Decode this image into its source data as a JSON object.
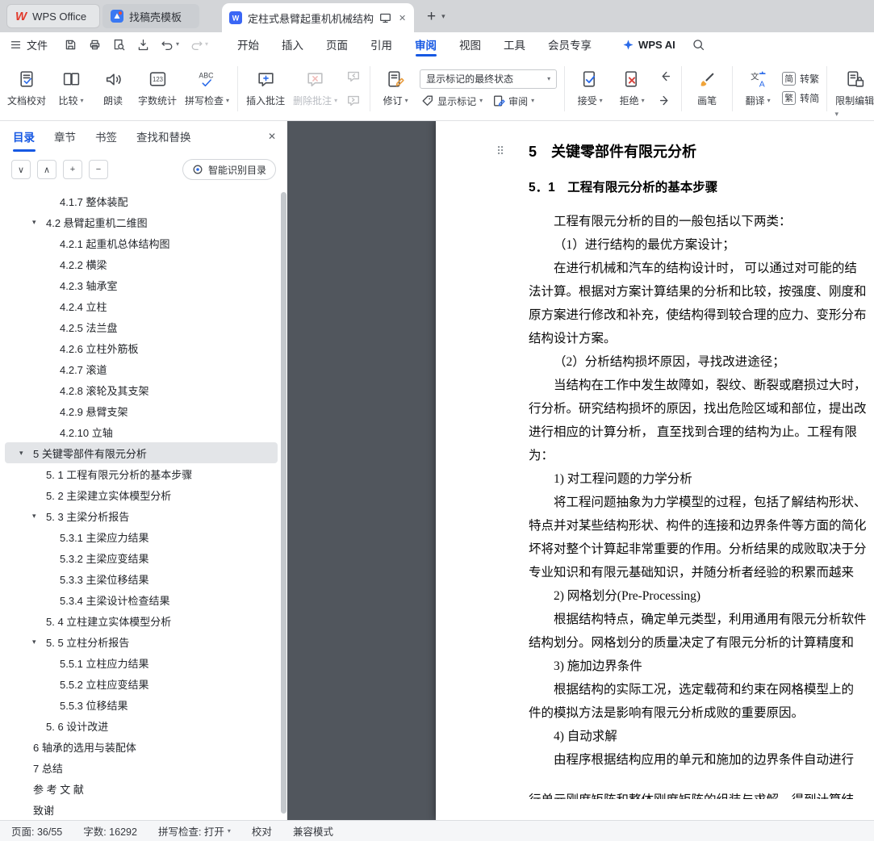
{
  "icons": {
    "close": "✕",
    "plus": "+",
    "caret": "▾",
    "tree_arrow": "▾",
    "chevron_down": "∨",
    "chevron_up": "∧",
    "minus": "−",
    "handle": "⠿"
  },
  "tabbar": {
    "home_tab": "WPS Office",
    "app_tab": "找稿壳模板",
    "doc_tab": "定柱式悬臂起重机机械结构设"
  },
  "menubar": {
    "file": "文件",
    "items": [
      {
        "label": "开始"
      },
      {
        "label": "插入"
      },
      {
        "label": "页面"
      },
      {
        "label": "引用"
      },
      {
        "label": "审阅",
        "active": true
      },
      {
        "label": "视图"
      },
      {
        "label": "工具"
      },
      {
        "label": "会员专享"
      }
    ],
    "wps_ai": "WPS AI"
  },
  "ribbon": {
    "doc_proof": "文档校对",
    "compare": "比较",
    "read_aloud": "朗读",
    "word_count": "字数统计",
    "spell_check": "拼写检查",
    "insert_comment": "插入批注",
    "delete_comment": "删除批注",
    "track_changes": "修订",
    "markup_state": "显示标记的最终状态",
    "show_markup": "显示标记",
    "review": "审阅",
    "accept": "接受",
    "reject": "拒绝",
    "brush": "画笔",
    "translate": "翻译",
    "jian": "简",
    "fan": "繁",
    "to_trad": "转繁",
    "to_simp": "转简",
    "restrict": "限制编辑"
  },
  "sidebar": {
    "tabs": [
      {
        "label": "目录",
        "active": true
      },
      {
        "label": "章节"
      },
      {
        "label": "书签"
      },
      {
        "label": "查找和替换"
      }
    ],
    "smart_button": "智能识别目录",
    "tree": [
      {
        "label": "4.1.7 整体装配",
        "level": 3
      },
      {
        "label": "4.2 悬臂起重机二维图",
        "level": 2,
        "arrow": true
      },
      {
        "label": "4.2.1 起重机总体结构图",
        "level": 3
      },
      {
        "label": "4.2.2 横梁",
        "level": 3
      },
      {
        "label": "4.2.3 轴承室",
        "level": 3
      },
      {
        "label": "4.2.4 立柱",
        "level": 3
      },
      {
        "label": "4.2.5 法兰盘",
        "level": 3
      },
      {
        "label": "4.2.6 立柱外筋板",
        "level": 3
      },
      {
        "label": "4.2.7 滚道",
        "level": 3
      },
      {
        "label": "4.2.8 滚轮及其支架",
        "level": 3
      },
      {
        "label": "4.2.9 悬臂支架",
        "level": 3
      },
      {
        "label": "4.2.10 立轴",
        "level": 3
      },
      {
        "label": "5 关键零部件有限元分析",
        "level": 1,
        "arrow": true,
        "selected": true
      },
      {
        "label": "5. 1 工程有限元分析的基本步骤",
        "level": 2
      },
      {
        "label": "5. 2 主梁建立实体模型分析",
        "level": 2
      },
      {
        "label": "5. 3 主梁分析报告",
        "level": 2,
        "arrow": true
      },
      {
        "label": "5.3.1 主梁应力结果",
        "level": 3
      },
      {
        "label": "5.3.2 主梁应变结果",
        "level": 3
      },
      {
        "label": "5.3.3 主梁位移结果",
        "level": 3
      },
      {
        "label": "5.3.4 主梁设计检查结果",
        "level": 3
      },
      {
        "label": "5. 4 立柱建立实体模型分析",
        "level": 2
      },
      {
        "label": "5. 5 立柱分析报告",
        "level": 2,
        "arrow": true
      },
      {
        "label": "5.5.1 立柱应力结果",
        "level": 3
      },
      {
        "label": "5.5.2 立柱应变结果",
        "level": 3
      },
      {
        "label": "5.5.3 位移结果",
        "level": 3
      },
      {
        "label": "5. 6 设计改进",
        "level": 2
      },
      {
        "label": "6 轴承的选用与装配体",
        "level": 1
      },
      {
        "label": "7 总结",
        "level": 1
      },
      {
        "label": "参 考 文 献",
        "level": 1
      },
      {
        "label": "致谢",
        "level": 1
      }
    ]
  },
  "document": {
    "heading1": "5　关键零部件有限元分析",
    "heading2": "5．1　工程有限元分析的基本步骤",
    "lines": [
      {
        "t": "工程有限元分析的目的一般包括以下两类：",
        "ind": true
      },
      {
        "t": "（1）进行结构的最优方案设计；",
        "ind": true
      },
      {
        "t": "在进行机械和汽车的结构设计时， 可以通过对可能的结",
        "ind": true
      },
      {
        "t": "法计算。根据对方案计算结果的分析和比较，按强度、刚度和"
      },
      {
        "t": "原方案进行修改和补充，使结构得到较合理的应力、变形分布"
      },
      {
        "t": "结构设计方案。"
      },
      {
        "t": "（2）分析结构损坏原因，寻找改进途径；",
        "ind": true
      },
      {
        "t": "当结构在工作中发生故障如，裂纹、断裂或磨损过大时，",
        "ind": true
      },
      {
        "t": "行分析。研究结构损坏的原因，找出危险区域和部位，提出改"
      },
      {
        "t": "进行相应的计算分析， 直至找到合理的结构为止。工程有限"
      },
      {
        "t": "为："
      },
      {
        "t": "1) 对工程问题的力学分析",
        "ind": true
      },
      {
        "t": "将工程问题抽象为力学模型的过程，包括了解结构形状、",
        "ind": true
      },
      {
        "t": "特点并对某些结构形状、构件的连接和边界条件等方面的简化"
      },
      {
        "t": "坏将对整个计算起非常重要的作用。分析结果的成败取决于分"
      },
      {
        "t": "专业知识和有限元基础知识，并随分析者经验的积累而越来"
      },
      {
        "t": "2) 网格划分(Pre-Processing)",
        "ind": true
      },
      {
        "t": "根据结构特点，确定单元类型，利用通用有限元分析软件",
        "ind": true
      },
      {
        "t": "结构划分。网格划分的质量决定了有限元分析的计算精度和"
      },
      {
        "t": "3) 施加边界条件",
        "ind": true
      },
      {
        "t": "根据结构的实际工况，选定载荷和约束在网格模型上的",
        "ind": true
      },
      {
        "t": "件的模拟方法是影响有限元分析成败的重要原因。"
      },
      {
        "t": "4) 自动求解",
        "ind": true
      },
      {
        "t": "由程序根据结构应用的单元和施加的边界条件自动进行",
        "ind": true
      },
      {
        "t": "行单元刚度矩阵和整体刚度矩阵的组装与求解，得到计算结",
        "clipped": true
      }
    ]
  },
  "statusbar": {
    "page": "页面: 36/55",
    "words": "字数: 16292",
    "spell": "拼写检查: 打开",
    "proofread": "校对",
    "mode": "兼容模式"
  }
}
